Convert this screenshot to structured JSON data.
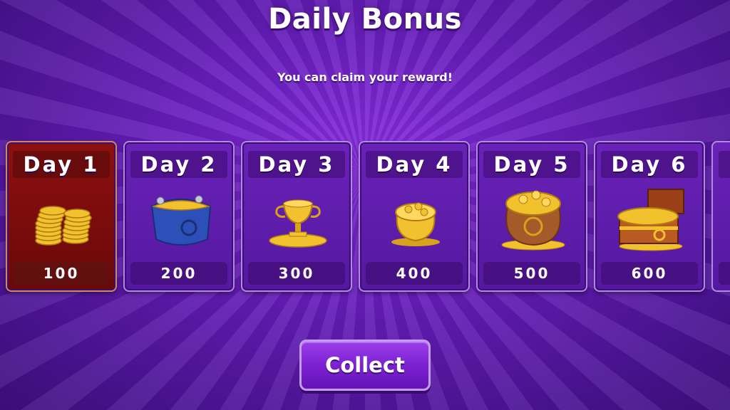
{
  "header": {
    "title": "Daily Bonus",
    "subtitle": "You can claim your reward!"
  },
  "rewards": [
    {
      "day": "Day 1",
      "amount": "100",
      "icon": "coin-stack-icon",
      "claimed": true
    },
    {
      "day": "Day 2",
      "amount": "200",
      "icon": "coin-purse-icon",
      "claimed": false
    },
    {
      "day": "Day 3",
      "amount": "300",
      "icon": "gold-trophy-icon",
      "claimed": false
    },
    {
      "day": "Day 4",
      "amount": "400",
      "icon": "gold-pot-icon",
      "claimed": false
    },
    {
      "day": "Day 5",
      "amount": "500",
      "icon": "gold-sack-icon",
      "claimed": false
    },
    {
      "day": "Day 6",
      "amount": "600",
      "icon": "treasure-chest-icon",
      "claimed": false
    }
  ],
  "actions": {
    "collect_label": "Collect"
  },
  "colors": {
    "background": "#5a1aa6",
    "claimed_card": "#8e1010",
    "card": "#6a22b8",
    "gold": "#f2c12e"
  }
}
